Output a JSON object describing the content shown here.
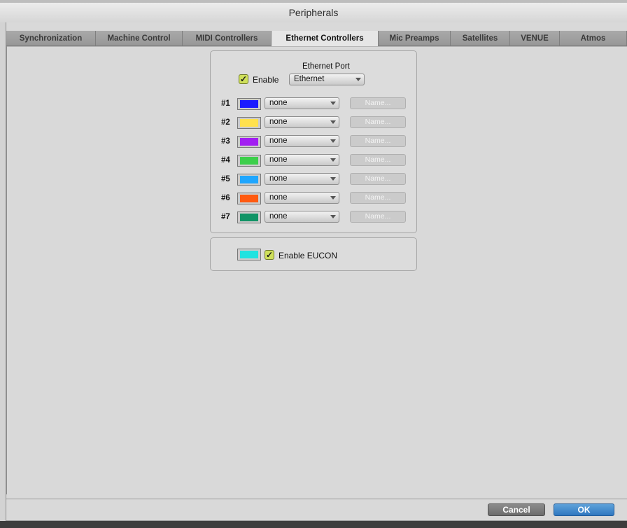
{
  "window": {
    "title": "Peripherals"
  },
  "tabs": [
    {
      "label": "Synchronization",
      "active": false
    },
    {
      "label": "Machine Control",
      "active": false
    },
    {
      "label": "MIDI Controllers",
      "active": false
    },
    {
      "label": "Ethernet Controllers",
      "active": true
    },
    {
      "label": "Mic Preamps",
      "active": false
    },
    {
      "label": "Satellites",
      "active": false
    },
    {
      "label": "VENUE",
      "active": false
    },
    {
      "label": "Atmos",
      "active": false
    }
  ],
  "ethernet": {
    "port_label": "Ethernet Port",
    "enable_label": "Enable",
    "enable_checked": true,
    "port_value": "Ethernet"
  },
  "controllers": [
    {
      "num": "#1",
      "color": "#1a1aff",
      "value": "none",
      "name_btn": "Name..."
    },
    {
      "num": "#2",
      "color": "#ffe14d",
      "value": "none",
      "name_btn": "Name..."
    },
    {
      "num": "#3",
      "color": "#a21ff2",
      "value": "none",
      "name_btn": "Name..."
    },
    {
      "num": "#4",
      "color": "#3ccf4a",
      "value": "none",
      "name_btn": "Name..."
    },
    {
      "num": "#5",
      "color": "#1fa6ff",
      "value": "none",
      "name_btn": "Name..."
    },
    {
      "num": "#6",
      "color": "#ff5a10",
      "value": "none",
      "name_btn": "Name..."
    },
    {
      "num": "#7",
      "color": "#109466",
      "value": "none",
      "name_btn": "Name..."
    }
  ],
  "eucon": {
    "color": "#1fe3e0",
    "label": "Enable EUCON",
    "checked": true
  },
  "footer": {
    "cancel_label": "Cancel",
    "ok_label": "OK"
  }
}
